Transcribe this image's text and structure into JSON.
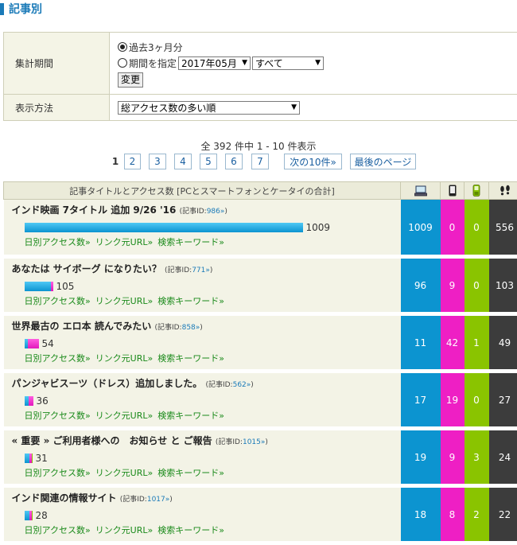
{
  "header": {
    "title": "記事別"
  },
  "settings": {
    "period_label": "集計期間",
    "opt_recent": "過去3ヶ月分",
    "opt_specify": "期間を指定",
    "month_select": "2017年05月",
    "range_select": "すべて",
    "change_button": "変更",
    "display_label": "表示方法",
    "sort_select": "総アクセス数の多い順"
  },
  "summary": "全 392 件中 1 - 10 件表示",
  "pager": {
    "current": "1",
    "pages": [
      "2",
      "3",
      "4",
      "5",
      "6",
      "7"
    ],
    "next": "次の10件»",
    "last": "最後のページ"
  },
  "table": {
    "header": "記事タイトルとアクセス数 [PCとスマートフォンとケータイの合計]",
    "icons": [
      "pc-icon",
      "smartphone-icon",
      "mobile-phone-icon",
      "footprints-icon"
    ],
    "colors": {
      "pc": "#0c94d0",
      "smartphone": "#ee1fc4",
      "mobile": "#8ac400",
      "total": "#3c3c3c"
    },
    "id_prefix": "(記事ID:",
    "id_suffix": ")",
    "link_daily": "日別アクセス数»",
    "link_referrer": "リンク元URL»",
    "link_keyword": "検索キーワード»",
    "rows": [
      {
        "title": "インド映画 7タイトル 追加 9/26 '16",
        "id": "986»",
        "bar_total": "1009",
        "pc": "1009",
        "sp": "0",
        "mb": "0",
        "total": "556"
      },
      {
        "title": "あなたは サイボーグ になりたい？",
        "id": "771»",
        "bar_total": "105",
        "pc": "96",
        "sp": "9",
        "mb": "0",
        "total": "103"
      },
      {
        "title": "世界最古の エロ本 読んでみたい",
        "id": "858»",
        "bar_total": "54",
        "pc": "11",
        "sp": "42",
        "mb": "1",
        "total": "49"
      },
      {
        "title": "パンジャビスーツ（ドレス）追加しました。",
        "id": "562»",
        "bar_total": "36",
        "pc": "17",
        "sp": "19",
        "mb": "0",
        "total": "27"
      },
      {
        "title": "« 重要 » ご利用者様への　お知らせ と ご報告",
        "id": "1015»",
        "bar_total": "31",
        "pc": "19",
        "sp": "9",
        "mb": "3",
        "total": "24"
      },
      {
        "title": "インド関連の情報サイト",
        "id": "1017»",
        "bar_total": "28",
        "pc": "18",
        "sp": "8",
        "mb": "2",
        "total": "22"
      }
    ]
  }
}
